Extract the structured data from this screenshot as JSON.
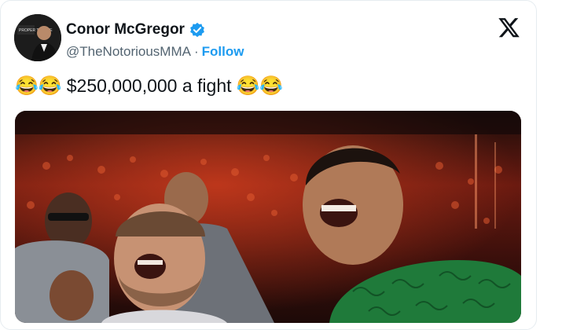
{
  "author": {
    "name": "Conor McGregor",
    "handle": "@TheNotoriousMMA",
    "separator": "·",
    "follow_label": "Follow",
    "avatar_text": "PROPER TWELVE"
  },
  "tweet": {
    "emoji_left": "😂😂",
    "text": "$250,000,000 a fight",
    "emoji_right": "😂😂"
  },
  "icons": {
    "verified": "verified-badge-icon",
    "platform": "x-logo-icon"
  },
  "colors": {
    "accent": "#1d9bf0",
    "text": "#0f1419",
    "muted": "#536471"
  }
}
